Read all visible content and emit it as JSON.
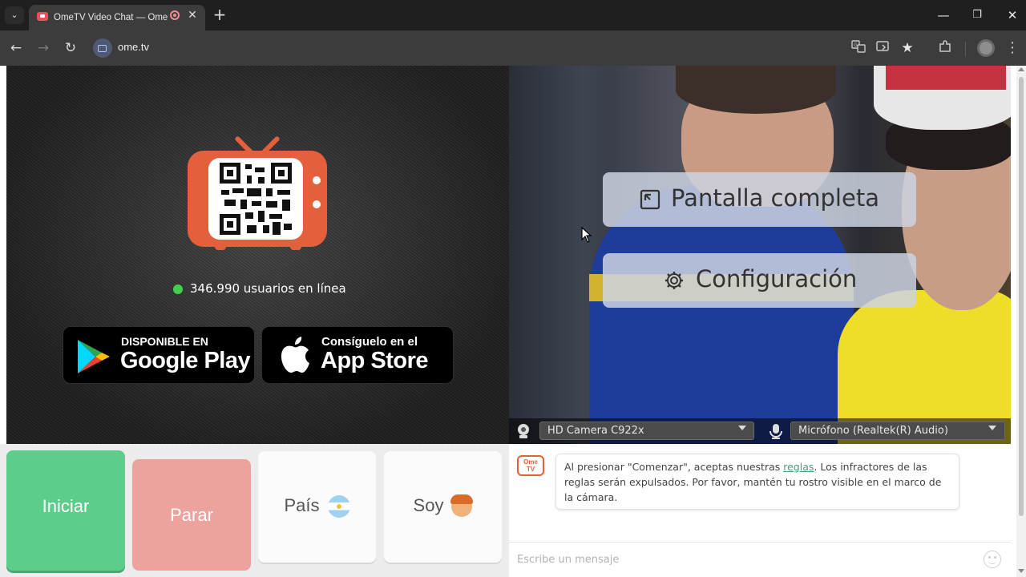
{
  "browser": {
    "tab_title": "OmeTV Video Chat — Ome",
    "url": "ome.tv",
    "tab_close": "✕",
    "new_tab": "+",
    "minimize": "—",
    "maximize": "❐",
    "close": "✕",
    "back": "←",
    "forward": "→",
    "reload": "↻"
  },
  "left_panel": {
    "online_count_text": "346.990 usuarios en línea",
    "online_dot_color": "#42d04a",
    "google_play": {
      "small": "DISPONIBLE EN",
      "big": "Google Play"
    },
    "app_store": {
      "small": "Consíguelo en el",
      "big": "App Store"
    },
    "tv_color": "#e4603c"
  },
  "video_overlay": {
    "fullscreen_label": "Pantalla completa",
    "settings_label": "Configuración",
    "camera_select": "HD Camera C922x",
    "mic_select": "Micrófono (Realtek(R) Audio)"
  },
  "controls": {
    "start_label": "Iniciar",
    "stop_label": "Parar",
    "country_label": "País",
    "me_label": "Soy",
    "start_color": "#5ccd8a",
    "stop_color": "#eda39d"
  },
  "chat": {
    "logo_text": "Ome TV",
    "message_before_link": "Al presionar \"Comenzar\", aceptas nuestras ",
    "message_link": "reglas",
    "message_after_link": ". Los infractores de las reglas serán expulsados. Por favor, mantén tu rostro visible en el marco de la cámara.",
    "input_placeholder": "Escribe un mensaje"
  },
  "icons": [
    "tab-list-icon",
    "recording-icon",
    "translate-icon",
    "cast-icon",
    "star-icon",
    "extensions-icon",
    "profile-icon",
    "fullscreen-icon",
    "gear-icon",
    "webcam-icon",
    "microphone-icon",
    "emoji-icon",
    "google-play-logo",
    "apple-logo"
  ]
}
